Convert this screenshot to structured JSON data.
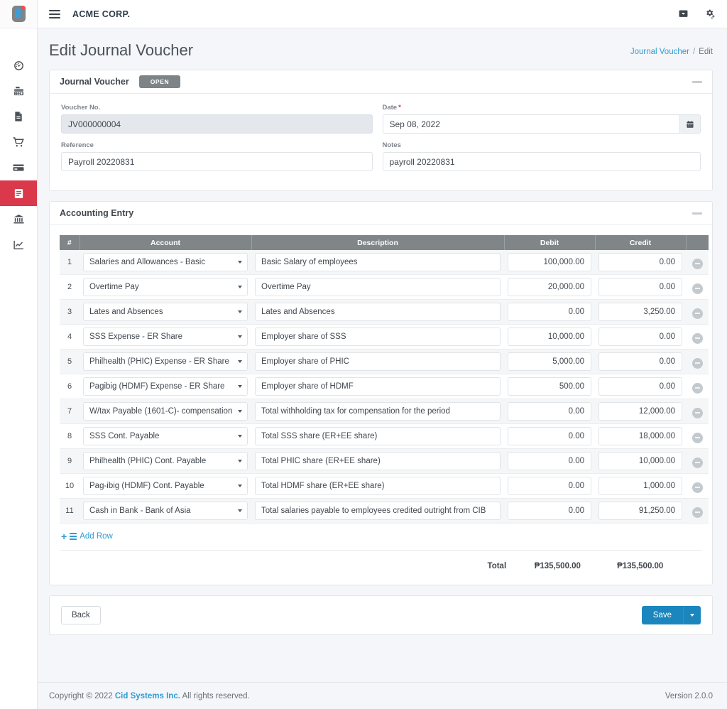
{
  "sidebar": {
    "logo_name": "app-logo",
    "items": [
      {
        "name": "dashboard",
        "icon": "speedometer-icon",
        "active": false
      },
      {
        "name": "point-of-sale",
        "icon": "cash-register-icon",
        "active": false
      },
      {
        "name": "documents",
        "icon": "document-icon",
        "active": false
      },
      {
        "name": "purchasing",
        "icon": "shopping-cart-icon",
        "active": false
      },
      {
        "name": "payments",
        "icon": "credit-card-icon",
        "active": false
      },
      {
        "name": "accounting",
        "icon": "ledger-book-icon",
        "active": true
      },
      {
        "name": "banking",
        "icon": "bank-icon",
        "active": false
      },
      {
        "name": "reports",
        "icon": "chart-line-icon",
        "active": false
      }
    ]
  },
  "topbar": {
    "menu_icon": "hamburger-icon",
    "brand": "ACME CORP.",
    "right_icons": [
      {
        "name": "screen-toggle-icon"
      },
      {
        "name": "settings-gear-icon"
      }
    ]
  },
  "page": {
    "title": "Edit Journal Voucher",
    "breadcrumb": {
      "link": "Journal Voucher",
      "separator": "/",
      "current": "Edit"
    }
  },
  "voucher_card": {
    "title": "Journal Voucher",
    "status": "OPEN",
    "collapse_label": "collapse",
    "fields": {
      "voucher_no": {
        "label": "Voucher No.",
        "value": "JV000000004",
        "readonly": true
      },
      "date": {
        "label": "Date",
        "required": true,
        "value": "Sep 08, 2022",
        "addon_icon": "calendar-icon"
      },
      "reference": {
        "label": "Reference",
        "value": "Payroll 20220831"
      },
      "notes": {
        "label": "Notes",
        "value": "payroll 20220831"
      }
    }
  },
  "entry_card": {
    "title": "Accounting Entry",
    "columns": [
      "#",
      "Account",
      "Description",
      "Debit",
      "Credit",
      ""
    ],
    "rows": [
      {
        "num": "1",
        "account": "Salaries and Allowances - Basic",
        "description": "Basic Salary of employees",
        "debit": "100,000.00",
        "credit": "0.00"
      },
      {
        "num": "2",
        "account": "Overtime Pay",
        "description": "Overtime Pay",
        "debit": "20,000.00",
        "credit": "0.00"
      },
      {
        "num": "3",
        "account": "Lates and Absences",
        "description": "Lates and Absences",
        "debit": "0.00",
        "credit": "3,250.00"
      },
      {
        "num": "4",
        "account": "SSS Expense - ER Share",
        "description": "Employer share of SSS",
        "debit": "10,000.00",
        "credit": "0.00"
      },
      {
        "num": "5",
        "account": "Philhealth (PHIC) Expense - ER Share",
        "description": "Employer share of PHIC",
        "debit": "5,000.00",
        "credit": "0.00"
      },
      {
        "num": "6",
        "account": "Pagibig (HDMF) Expense - ER Share",
        "description": "Employer share of HDMF",
        "debit": "500.00",
        "credit": "0.00"
      },
      {
        "num": "7",
        "account": "W/tax Payable (1601-C)- compensation",
        "description": "Total withholding tax for compensation for the period",
        "debit": "0.00",
        "credit": "12,000.00"
      },
      {
        "num": "8",
        "account": "SSS Cont. Payable",
        "description": "Total SSS share (ER+EE share)",
        "debit": "0.00",
        "credit": "18,000.00"
      },
      {
        "num": "9",
        "account": "Philhealth (PHIC) Cont. Payable",
        "description": "Total PHIC share (ER+EE share)",
        "debit": "0.00",
        "credit": "10,000.00"
      },
      {
        "num": "10",
        "account": "Pag-ibig (HDMF) Cont. Payable",
        "description": "Total HDMF share (ER+EE share)",
        "debit": "0.00",
        "credit": "1,000.00"
      },
      {
        "num": "11",
        "account": "Cash in Bank - Bank of Asia",
        "description": "Total salaries payable to employees credited outright from CIB",
        "debit": "0.00",
        "credit": "91,250.00"
      }
    ],
    "add_row_label": "Add Row",
    "totals": {
      "label": "Total",
      "debit": "₱135,500.00",
      "credit": "₱135,500.00"
    }
  },
  "actions": {
    "back_label": "Back",
    "save_label": "Save"
  },
  "footer": {
    "copyright_prefix": "Copyright © 2022",
    "company": "Cid Systems Inc.",
    "copyright_suffix": "All rights reserved.",
    "version": "Version 2.0.0"
  },
  "colors": {
    "accent_blue": "#2f9cd3",
    "save_blue": "#1b86bd",
    "active_red": "#d9394b",
    "table_header_gray": "#808588",
    "badge_gray": "#7d8387"
  }
}
